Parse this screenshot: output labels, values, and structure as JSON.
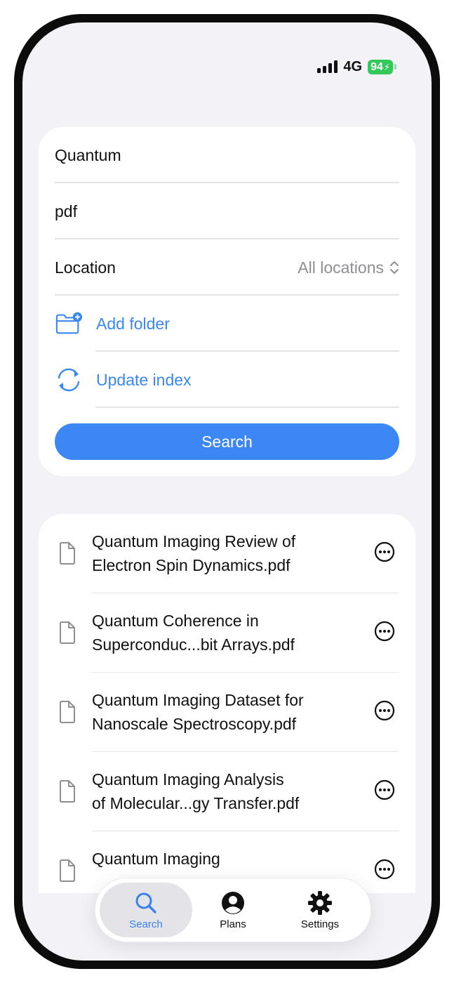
{
  "status": {
    "network": "4G",
    "battery": "94"
  },
  "search": {
    "query": "Quantum",
    "file_type": "pdf",
    "location_label": "Location",
    "location_value": "All locations",
    "add_folder": "Add folder",
    "update_index": "Update index",
    "search_button": "Search"
  },
  "results": [
    {
      "line1": "Quantum Imaging Review of",
      "line2": "Electron Spin Dynamics.pdf"
    },
    {
      "line1": "Quantum Coherence in",
      "line2": "Superconduc...bit Arrays.pdf"
    },
    {
      "line1": "Quantum Imaging Dataset for",
      "line2": "Nanoscale Spectroscopy.pdf"
    },
    {
      "line1": "Quantum Imaging Analysis",
      "line2": "of Molecular...gy Transfer.pdf"
    },
    {
      "line1": "Quantum Imaging",
      "line2": ""
    }
  ],
  "tabs": [
    {
      "label": "Search",
      "icon": "search-icon",
      "active": true
    },
    {
      "label": "Plans",
      "icon": "person-icon",
      "active": false
    },
    {
      "label": "Settings",
      "icon": "gear-icon",
      "active": false
    }
  ],
  "colors": {
    "accent": "#3c87f3",
    "battery": "#34c759",
    "background": "#f2f2f7"
  }
}
